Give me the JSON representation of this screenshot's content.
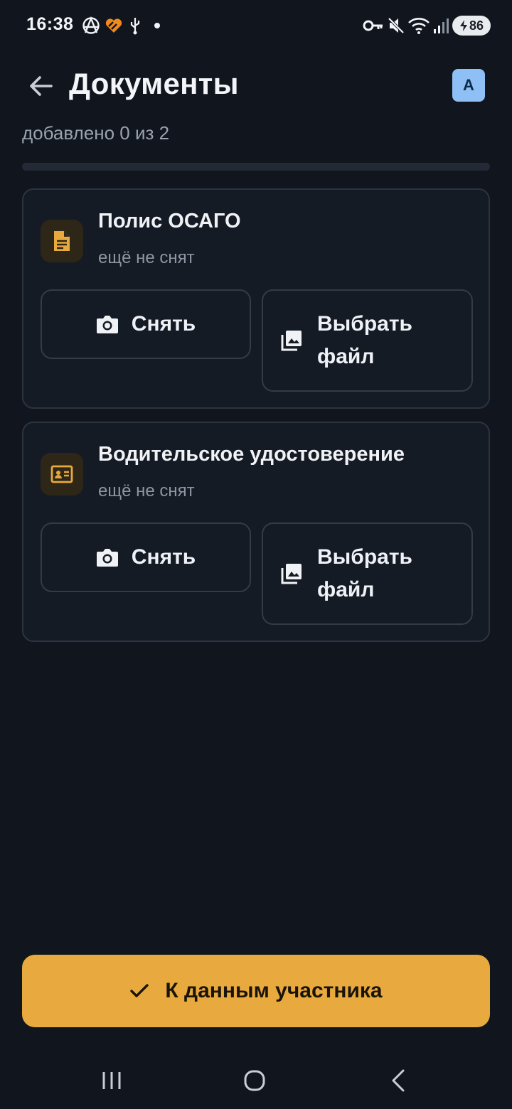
{
  "status_bar": {
    "time": "16:38",
    "battery": "86",
    "icons": [
      "anarchy-icon",
      "heart-app-icon",
      "usb-icon",
      "dot-icon",
      "key-icon",
      "mute-icon",
      "wifi-icon",
      "signal-icon",
      "battery-charging-icon"
    ]
  },
  "header": {
    "title": "Документы",
    "avatar_letter": "A"
  },
  "progress": {
    "text": "добавлено 0 из 2",
    "done": 0,
    "total": 2,
    "fraction": 0.0
  },
  "documents": [
    {
      "title": "Полис ОСАГО",
      "status": "ещё не снят",
      "icon": "document-icon",
      "shoot_label": "Снять",
      "file_label": "Выбрать\nфайл"
    },
    {
      "title": "Водительское удостоверение",
      "status": "ещё не снят",
      "icon": "id-card-icon",
      "shoot_label": "Снять",
      "file_label": "Выбрать\nфайл"
    }
  ],
  "primary_action": {
    "label": "К данным участника"
  },
  "colors": {
    "background": "#10151e",
    "card": "#151b25",
    "accent": "#e8aa3e",
    "avatar": "#8fc0f5"
  }
}
